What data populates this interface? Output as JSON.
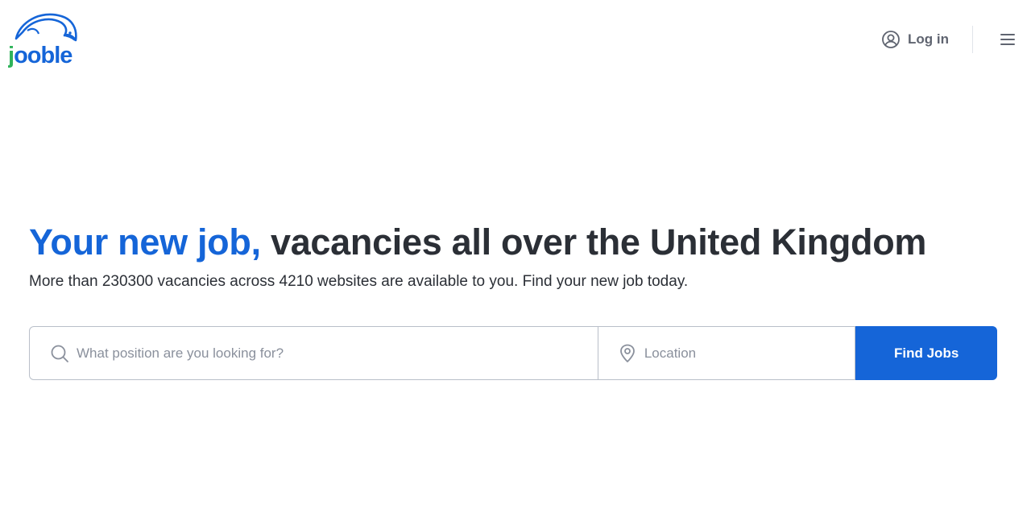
{
  "header": {
    "logo_text": "jooble",
    "login_label": "Log in",
    "login_icon": "user-circle-icon",
    "menu_icon": "hamburger-menu-icon"
  },
  "hero": {
    "title_accent": "Your new job,",
    "title_rest": "vacancies all over the United Kingdom",
    "subtitle": "More than 230300 vacancies across 4210 websites are available to you. Find your new job today."
  },
  "search": {
    "position_placeholder": "What position are you looking for?",
    "position_value": "",
    "position_icon": "search-icon",
    "location_placeholder": "Location",
    "location_value": "",
    "location_icon": "location-pin-icon",
    "button_label": "Find Jobs"
  },
  "colors": {
    "brand_blue": "#1565d8",
    "logo_green": "#2fb35a",
    "text_dark": "#2b2f36",
    "text_muted": "#5f6470",
    "border": "#b9bfc9"
  }
}
